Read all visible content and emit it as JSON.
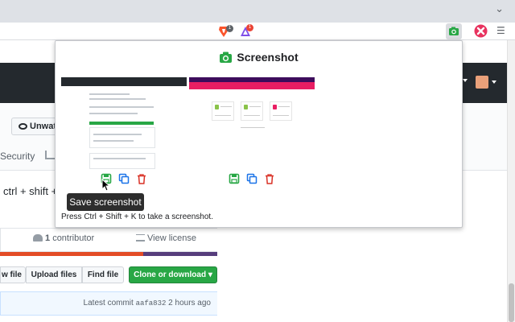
{
  "browser": {
    "brave_shield_count": "1",
    "rewards_count": "1",
    "icons": [
      "brave-shields-icon",
      "brave-rewards-icon",
      "screenshot-extension-icon",
      "x-extension-icon",
      "menu-icon",
      "tab-search-chevron-icon"
    ]
  },
  "github": {
    "unwatch_label": "Unwatch",
    "security_tab": "Security",
    "description": "ctrl + shift + K",
    "contributor_count": "1",
    "contributor_label": "contributor",
    "view_license": "View license",
    "languages": [
      {
        "color": "#e34c26",
        "fraction": 0.66
      },
      {
        "color": "#563d7c",
        "fraction": 0.34
      }
    ],
    "buttons": {
      "new_file": "w file",
      "upload": "Upload files",
      "find": "Find file",
      "clone": "Clone or download"
    },
    "commit": {
      "prefix": "Latest commit",
      "sha": "aafa832",
      "time": "2 hours ago"
    }
  },
  "popup": {
    "title": "Screenshot",
    "tooltip": "Save screenshot",
    "hint": "Press Ctrl + Shift + K to take a screenshot.",
    "action_icons": [
      "save-icon",
      "copy-icon",
      "delete-icon"
    ],
    "accent_colors": {
      "save": "#28a745",
      "copy": "#1a73e8",
      "delete": "#d93025"
    }
  }
}
